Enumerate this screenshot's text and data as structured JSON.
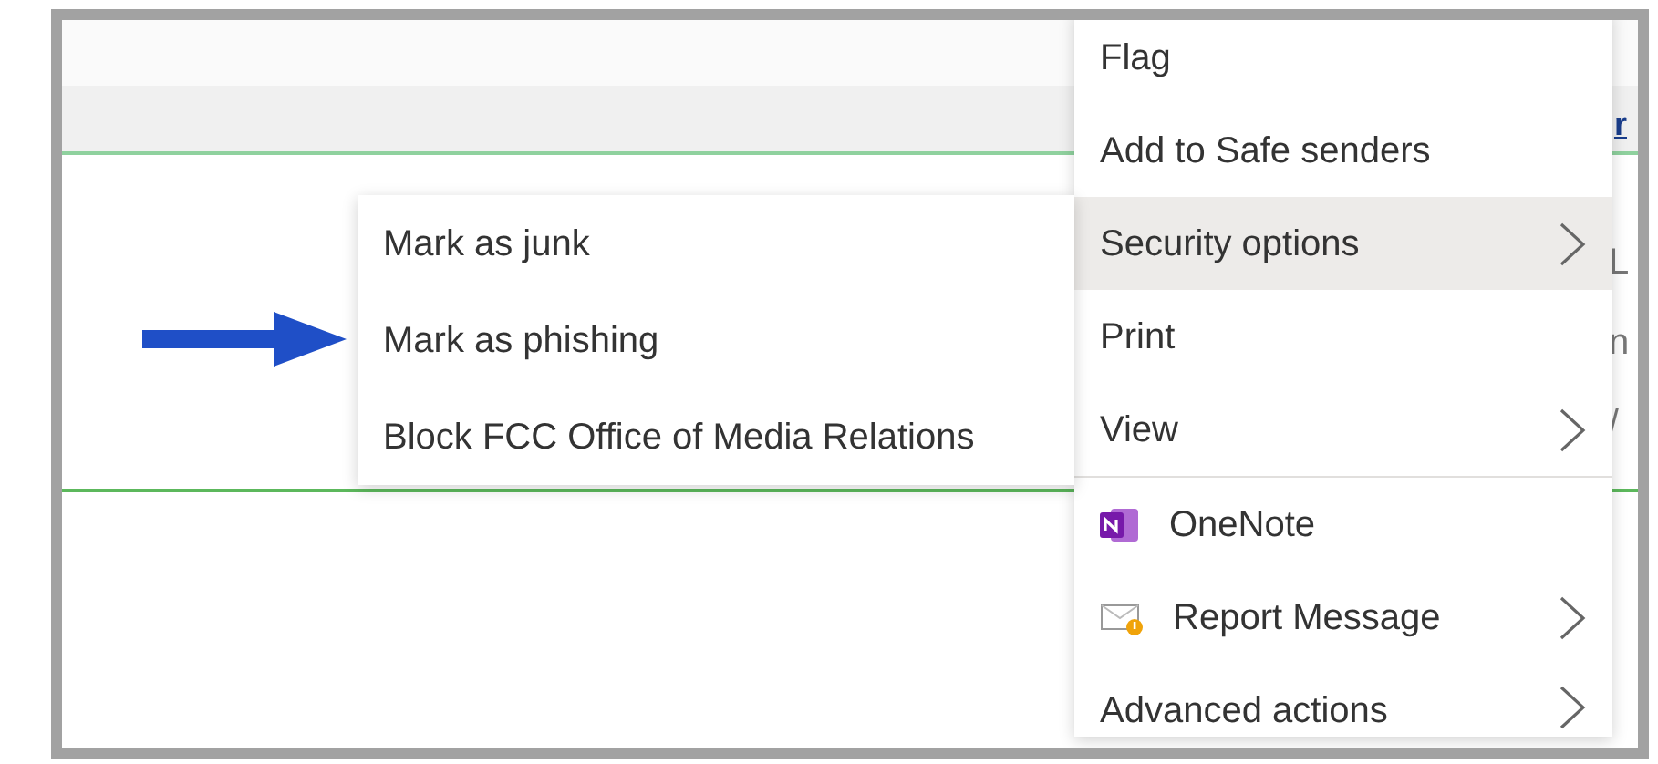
{
  "background": {
    "link": "r",
    "fragments": [
      "L",
      "n",
      "/"
    ]
  },
  "context_menu": {
    "items": [
      {
        "label": "Flag",
        "kind": "plain",
        "selected": false
      },
      {
        "label": "Add to Safe senders",
        "kind": "plain",
        "selected": false
      },
      {
        "label": "Security options",
        "kind": "submenu",
        "selected": true
      },
      {
        "label": "Print",
        "kind": "plain",
        "selected": false
      },
      {
        "label": "View",
        "kind": "submenu",
        "selected": false,
        "divider_after": true
      },
      {
        "label": "OneNote",
        "kind": "onenote",
        "selected": false
      },
      {
        "label": "Report Message",
        "kind": "report",
        "selected": false
      },
      {
        "label": "Advanced actions",
        "kind": "submenu",
        "selected": false
      }
    ]
  },
  "submenu": {
    "items": [
      {
        "label": "Mark as junk",
        "pointed": false
      },
      {
        "label": "Mark as phishing",
        "pointed": true
      },
      {
        "label": "Block FCC Office of Media Relations",
        "pointed": false
      }
    ]
  }
}
